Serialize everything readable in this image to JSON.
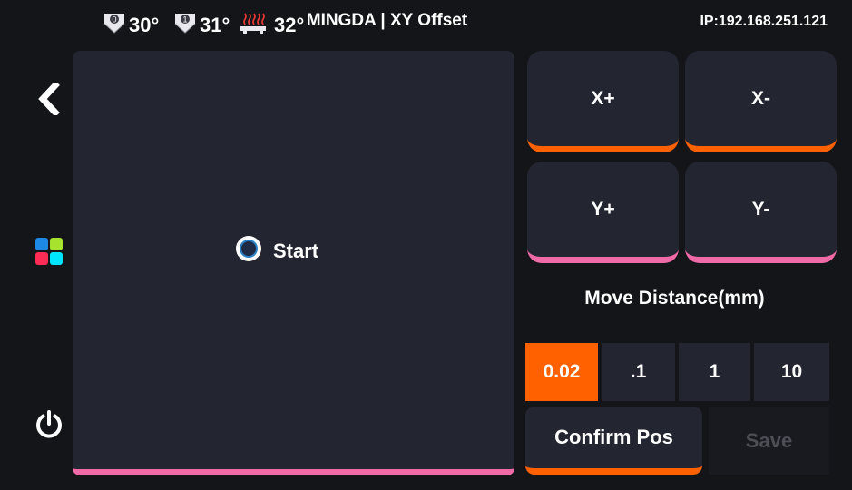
{
  "header": {
    "extruder0": {
      "icon": "extruder-0-icon",
      "badge": "0",
      "temp": "30°"
    },
    "extruder1": {
      "icon": "extruder-1-icon",
      "badge": "1",
      "temp": "31°"
    },
    "bed": {
      "icon": "heated-bed-icon",
      "temp": "32°"
    },
    "title": "MINGDA | XY Offset",
    "ip": "IP:192.168.251.121"
  },
  "sidebar": {
    "back": "back-arrow-icon",
    "apps": "apps-grid-icon",
    "power": "power-icon"
  },
  "panel": {
    "start_label": "Start",
    "start_icon": "radio-target-icon"
  },
  "jog": {
    "x_plus": "X+",
    "x_minus": "X-",
    "y_plus": "Y+",
    "y_minus": "Y-"
  },
  "move": {
    "label": "Move Distance(mm)",
    "options": [
      "0.02",
      ".1",
      "1",
      "10"
    ],
    "selected": "0.02"
  },
  "actions": {
    "confirm": "Confirm Pos",
    "save": "Save"
  },
  "colors": {
    "background": "#141519",
    "panel": "#232530",
    "accent_orange": "#ff6000",
    "accent_pink": "#f06aa8",
    "disabled_text": "#4d4e55"
  }
}
